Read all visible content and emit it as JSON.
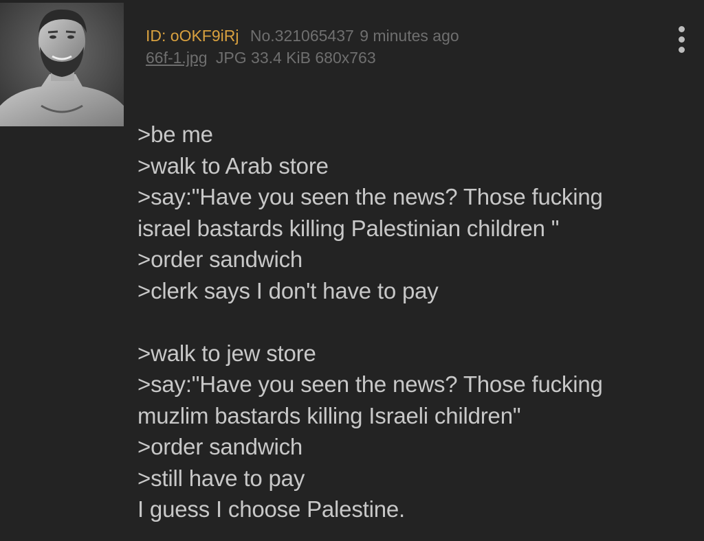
{
  "post": {
    "poster_id": "ID: oOKF9iRj",
    "post_number": "No.321065437",
    "time_ago": "9 minutes ago",
    "file": {
      "name": "66f-1.jpg",
      "info": "JPG 33.4 KiB 680x763"
    },
    "thumbnail_icon": "avatar-photo",
    "menu_icon": "vertical-dots-icon",
    "lines": [
      ">be me",
      ">walk to Arab store",
      ">say:\"Have you seen the news? Those fucking",
      "israel bastards killing Palestinian children \"",
      ">order sandwich",
      ">clerk says I don't have to pay",
      "",
      ">walk to jew store",
      ">say:\"Have you seen the news? Those fucking",
      "muzlim bastards killing Israeli children\"",
      ">order sandwich",
      ">still have to pay",
      "I guess I choose Palestine."
    ]
  },
  "colors": {
    "background": "#232323",
    "id_color": "#d9a13f",
    "meta_color": "#6f6f6f",
    "text_color": "#c8c8c8"
  }
}
